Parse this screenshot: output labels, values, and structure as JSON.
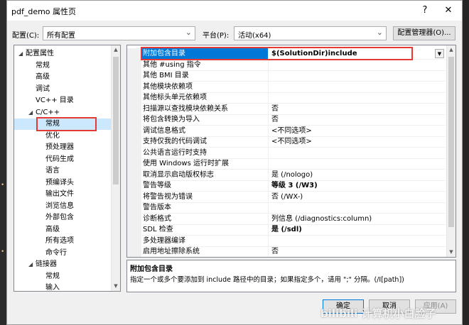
{
  "window": {
    "title": "pdf_demo 属性页",
    "help": "?",
    "close": "✕"
  },
  "config": {
    "label": "配置(C):",
    "value": "所有配置"
  },
  "platform": {
    "label": "平台(P):",
    "value": "活动(x64)"
  },
  "config_manager_button": "配置管理器(O)...",
  "tree": [
    {
      "label": "配置属性",
      "expander": "◢",
      "indent": 0
    },
    {
      "label": "常规",
      "indent": 1
    },
    {
      "label": "高级",
      "indent": 1
    },
    {
      "label": "调试",
      "indent": 1
    },
    {
      "label": "VC++ 目录",
      "indent": 1
    },
    {
      "label": "C/C++",
      "expander": "◢",
      "indent": 1
    },
    {
      "label": "常规",
      "indent": 2,
      "selected": true
    },
    {
      "label": "优化",
      "indent": 2
    },
    {
      "label": "预处理器",
      "indent": 2
    },
    {
      "label": "代码生成",
      "indent": 2
    },
    {
      "label": "语言",
      "indent": 2
    },
    {
      "label": "预编译头",
      "indent": 2
    },
    {
      "label": "输出文件",
      "indent": 2
    },
    {
      "label": "浏览信息",
      "indent": 2
    },
    {
      "label": "外部包含",
      "indent": 2
    },
    {
      "label": "高级",
      "indent": 2
    },
    {
      "label": "所有选项",
      "indent": 2
    },
    {
      "label": "命令行",
      "indent": 2
    },
    {
      "label": "链接器",
      "expander": "◢",
      "indent": 1
    },
    {
      "label": "常规",
      "indent": 2
    },
    {
      "label": "输入",
      "indent": 2
    }
  ],
  "properties": [
    {
      "name": "附加包含目录",
      "value": "$(SolutionDir)include",
      "selected": true
    },
    {
      "name": "其他 #using 指令",
      "value": ""
    },
    {
      "name": "其他 BMI 目录",
      "value": ""
    },
    {
      "name": "其他模块依赖项",
      "value": ""
    },
    {
      "name": "其他标头单元依赖项",
      "value": ""
    },
    {
      "name": "扫描源以查找模块依赖关系",
      "value": "否"
    },
    {
      "name": "将包含转换为导入",
      "value": "否"
    },
    {
      "name": "调试信息格式",
      "value": "<不同选项>"
    },
    {
      "name": "支持仅我的代码调试",
      "value": "<不同选项>"
    },
    {
      "name": "公共语言运行时支持",
      "value": ""
    },
    {
      "name": "使用 Windows 运行时扩展",
      "value": ""
    },
    {
      "name": "取消显示启动版权标志",
      "value": "是 (/nologo)"
    },
    {
      "name": "警告等级",
      "value": "等级 3 (/W3)",
      "bold": true
    },
    {
      "name": "将警告视为错误",
      "value": "否 (/WX-)"
    },
    {
      "name": "警告版本",
      "value": ""
    },
    {
      "name": "诊断格式",
      "value": "列信息 (/diagnostics:column)"
    },
    {
      "name": "SDL 检查",
      "value": "是 (/sdl)",
      "bold": true
    },
    {
      "name": "多处理器编译",
      "value": ""
    },
    {
      "name": "启用地址擦除系统",
      "value": "否"
    }
  ],
  "description": {
    "title": "附加包含目录",
    "text": "指定一个或多个要添加到 include 路径中的目录；如果指定多个，请用 \";\" 分隔。(/I[path])"
  },
  "buttons": {
    "ok": "确定",
    "cancel": "取消",
    "apply": "应用(A)"
  },
  "watermark": "bilibili 计算机小白脸子",
  "colors": {
    "selection": "#0078d7",
    "tree_selection": "#cce8ff",
    "highlight_box": "#e53935"
  }
}
